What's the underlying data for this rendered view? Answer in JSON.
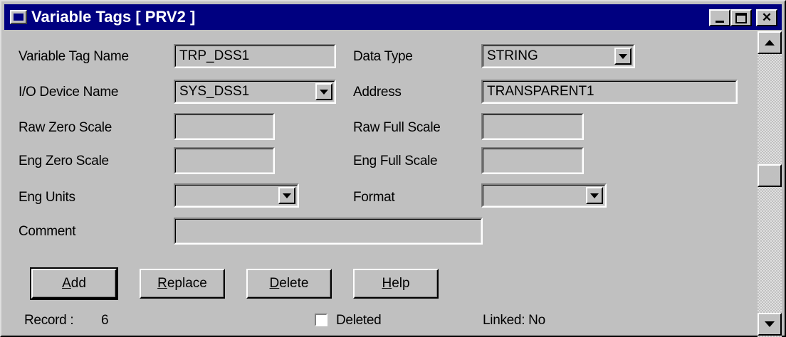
{
  "window": {
    "title": "Variable Tags [ PRV2 ]"
  },
  "form": {
    "variable_tag_name": {
      "label": "Variable Tag Name",
      "value": "TRP_DSS1"
    },
    "data_type": {
      "label": "Data Type",
      "value": "STRING"
    },
    "io_device_name": {
      "label": "I/O Device Name",
      "value": "SYS_DSS1"
    },
    "address": {
      "label": "Address",
      "value": "TRANSPARENT1"
    },
    "raw_zero_scale": {
      "label": "Raw Zero Scale",
      "value": ""
    },
    "raw_full_scale": {
      "label": "Raw Full Scale",
      "value": ""
    },
    "eng_zero_scale": {
      "label": "Eng Zero Scale",
      "value": ""
    },
    "eng_full_scale": {
      "label": "Eng Full Scale",
      "value": ""
    },
    "eng_units": {
      "label": "Eng Units",
      "value": ""
    },
    "format": {
      "label": "Format",
      "value": ""
    },
    "comment": {
      "label": "Comment",
      "value": ""
    }
  },
  "buttons": {
    "add": {
      "hot": "A",
      "rest": "dd"
    },
    "replace": {
      "hot": "R",
      "rest": "eplace"
    },
    "delete": {
      "hot": "D",
      "rest": "elete"
    },
    "help": {
      "hot": "H",
      "rest": "elp"
    }
  },
  "status": {
    "record_label": "Record :",
    "record_value": "6",
    "deleted_label": "Deleted",
    "deleted_checked": false,
    "linked": "Linked: No"
  },
  "colors": {
    "titlebar": "#000080",
    "face": "#c0c0c0"
  }
}
